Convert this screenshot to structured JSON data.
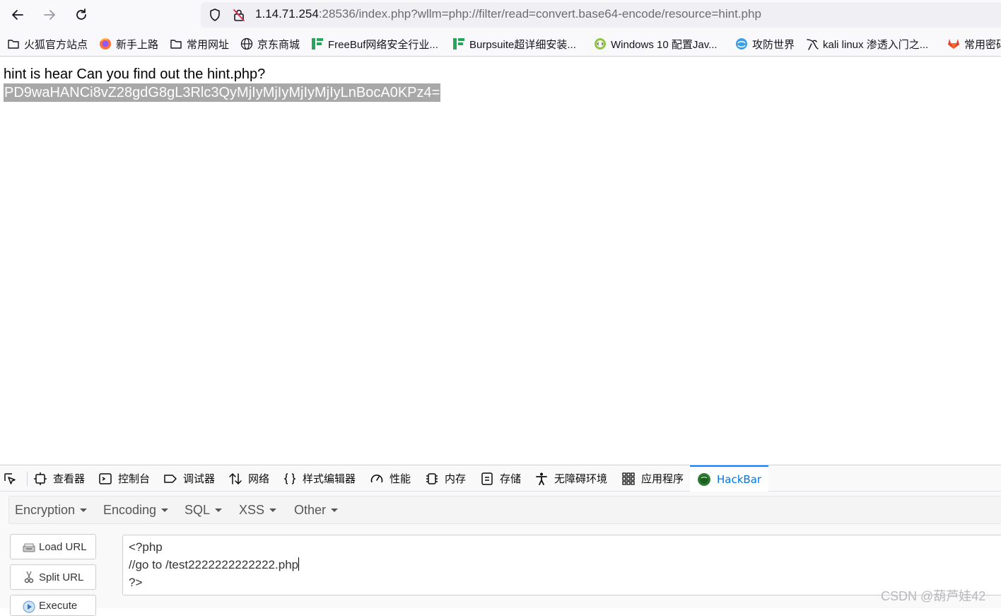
{
  "navbar": {
    "back_icon": "arrow-left-icon",
    "forward_icon": "arrow-right-icon",
    "reload_icon": "reload-icon",
    "url_host": "1.14.71.254",
    "url_rest": ":28536/index.php?wllm=php://filter/read=convert.base64-encode/resource=hint.php"
  },
  "bookmarks": [
    {
      "label": "火狐官方站点",
      "icon": "folder-icon"
    },
    {
      "label": "新手上路",
      "icon": "firefox-icon"
    },
    {
      "label": "常用网址",
      "icon": "folder-icon"
    },
    {
      "label": "京东商城",
      "icon": "globe-icon"
    },
    {
      "label": "FreeBuf网络安全行业...",
      "icon": "freebuf-icon"
    },
    {
      "label": "Burpsuite超详细安装...",
      "icon": "freebuf-icon"
    },
    {
      "label": "Windows 10 配置Jav...",
      "icon": "code-icon"
    },
    {
      "label": "攻防世界",
      "icon": "globe-icon"
    },
    {
      "label": "kali linux 渗透入门之...",
      "icon": "kali-icon"
    },
    {
      "label": "常用密码",
      "icon": "gitlab-icon"
    }
  ],
  "page": {
    "hint_text": "hint is hear Can you find out the hint.php?",
    "base64_text": "PD9waHANCi8vZ28gdG8gL3Rlc3QyMjIyMjIyMjIyMjIyLnBocA0KPz4="
  },
  "devtools": {
    "tabs": [
      {
        "label": "查看器",
        "icon": "inspector-icon"
      },
      {
        "label": "控制台",
        "icon": "console-icon"
      },
      {
        "label": "调试器",
        "icon": "debugger-icon"
      },
      {
        "label": "网络",
        "icon": "network-icon"
      },
      {
        "label": "样式编辑器",
        "icon": "braces-icon"
      },
      {
        "label": "性能",
        "icon": "gauge-icon"
      },
      {
        "label": "内存",
        "icon": "memory-icon"
      },
      {
        "label": "存储",
        "icon": "storage-icon"
      },
      {
        "label": "无障碍环境",
        "icon": "accessibility-icon"
      },
      {
        "label": "应用程序",
        "icon": "grid-icon"
      },
      {
        "label": "HackBar",
        "icon": "hackbar-icon",
        "active": true
      }
    ],
    "hackbar": {
      "menu": [
        "Encryption",
        "Encoding",
        "SQL",
        "XSS",
        "Other"
      ],
      "buttons": {
        "load_url": "Load URL",
        "split_url": "Split URL",
        "execute": "Execute"
      },
      "textarea_lines": [
        "<?php",
        "//go to /test2222222222222.php",
        "?>"
      ]
    }
  },
  "watermark": "CSDN @葫芦娃42",
  "colors": {
    "accent": "#0a84ff",
    "selection": "#a8a8a8"
  }
}
